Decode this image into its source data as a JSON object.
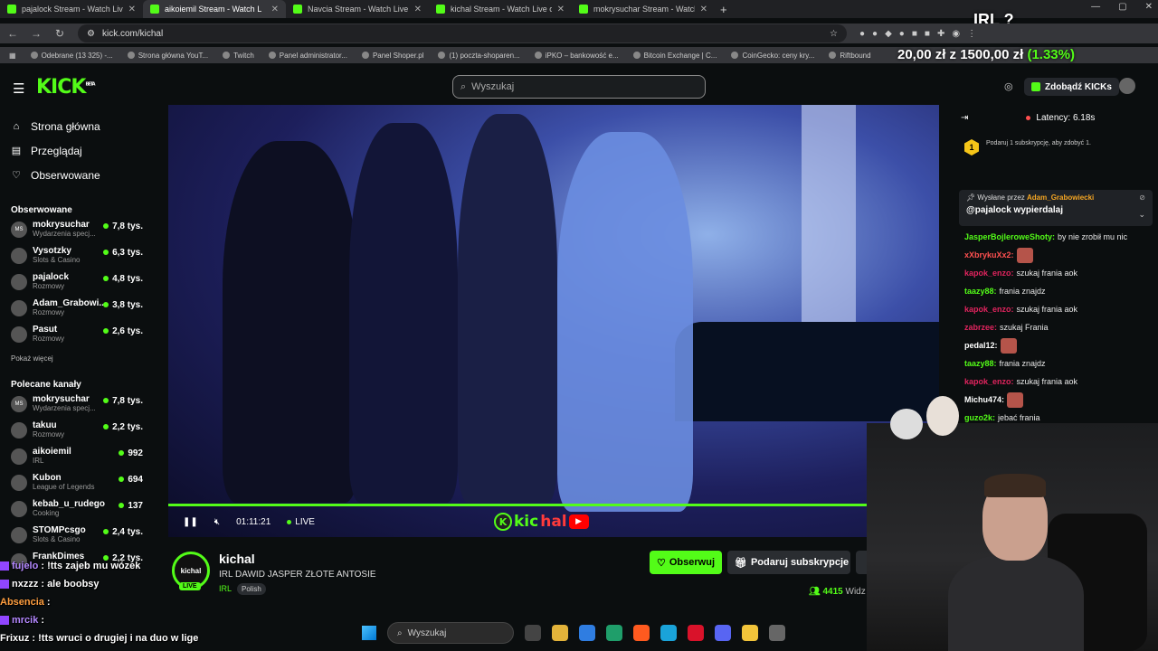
{
  "browser": {
    "tabs": [
      {
        "title": "pajalock Stream - Watch Live on"
      },
      {
        "title": "aikoiemil Stream - Watch L"
      },
      {
        "title": "Navcia Stream - Watch Live on"
      },
      {
        "title": "kichal Stream - Watch Live on"
      },
      {
        "title": "mokrysuchar Stream - Watch Li"
      }
    ],
    "new_tab": "+",
    "url": "kick.com/kichal",
    "bookmarks": [
      "Odebrane (13 325) -...",
      "Strona główna YouT...",
      "Twitch",
      "Panel administrator...",
      "Panel Shoper.pl",
      "(1) poczta-shoparen...",
      "iPKO – bankowość e...",
      "Bitcoin Exchange | C...",
      "CoinGecko: ceny kry...",
      "Riftbound"
    ]
  },
  "overlay": {
    "irl": "IRL ?",
    "price_a": "20,00 zł",
    "price_b": "1500,00 zł",
    "price_pct": "(1.33%)"
  },
  "header": {
    "logo": "KICK",
    "logo_badge": "BETA",
    "search_placeholder": "Wyszukaj",
    "kicks_button": "Zdobądź KICKs"
  },
  "sidebar": {
    "nav": [
      {
        "label": "Strona główna",
        "icon": "home-icon"
      },
      {
        "label": "Przeglądaj",
        "icon": "browse-icon"
      },
      {
        "label": "Obserwowane",
        "icon": "heart-icon"
      }
    ],
    "followed_title": "Obserwowane",
    "followed": [
      {
        "name": "mokrysuchar",
        "category": "Wydarzenia specj...",
        "viewers": "7,8 tys.",
        "avatar": "MS"
      },
      {
        "name": "Vysotzky",
        "category": "Slots & Casino",
        "viewers": "6,3 tys.",
        "avatar": ""
      },
      {
        "name": "pajalock",
        "category": "Rozmowy",
        "viewers": "4,8 tys.",
        "avatar": ""
      },
      {
        "name": "Adam_Grabowi...",
        "category": "Rozmowy",
        "viewers": "3,8 tys.",
        "avatar": ""
      },
      {
        "name": "Pasut",
        "category": "Rozmowy",
        "viewers": "2,6 tys.",
        "avatar": ""
      }
    ],
    "show_more": "Pokaż więcej",
    "recommended_title": "Polecane kanały",
    "recommended": [
      {
        "name": "mokrysuchar",
        "category": "Wydarzenia specj...",
        "viewers": "7,8 tys.",
        "avatar": "MS"
      },
      {
        "name": "takuu",
        "category": "Rozmowy",
        "viewers": "2,2 tys.",
        "avatar": ""
      },
      {
        "name": "aikoiemil",
        "category": "IRL",
        "viewers": "992",
        "avatar": ""
      },
      {
        "name": "Kubon",
        "category": "League of Legends",
        "viewers": "694",
        "avatar": ""
      },
      {
        "name": "kebab_u_rudego",
        "category": "Cooking",
        "viewers": "137",
        "avatar": ""
      },
      {
        "name": "STOMPcsgo",
        "category": "Slots & Casino",
        "viewers": "2,4 tys.",
        "avatar": ""
      },
      {
        "name": "FrankDimes",
        "category": "",
        "viewers": "2,2 tys.",
        "avatar": ""
      }
    ]
  },
  "player": {
    "time": "01:11:21",
    "live": "LIVE",
    "progress": 0.91,
    "brand_k": "K",
    "brand_a": "kic",
    "brand_b": "hal",
    "brand_yt": "▶"
  },
  "stream": {
    "channel": "kichal",
    "avatar_text": "kichal",
    "live_tag": "LIVE",
    "title": "IRL DAWID JASPER ZŁOTE ANTOSIE",
    "category": "IRL",
    "language": "Polish",
    "follow": "Obserwuj",
    "subscribe": "Podaruj subskrypcje",
    "viewers": "4415",
    "viewers_label": "Widz"
  },
  "chat": {
    "latency": "Latency: 6.18s",
    "goal_badge": "1",
    "goal_text": "Podaruj 1 subskrypcję, aby zdobyć 1.",
    "pinned_by_label": "Wysłane przez",
    "pinned_by_user": "Adam_Grabowiecki",
    "pinned_message": "@pajalock wypierdalaj",
    "messages": [
      {
        "user": "JasperBojleroweShoty:",
        "text": "by nie zrobił mu nic",
        "color": "#53fc18",
        "emote": false
      },
      {
        "user": "xXbrykuXx2:",
        "text": "",
        "color": "#ff5050",
        "emote": true
      },
      {
        "user": "kapok_enzo:",
        "text": "szukaj frania aok",
        "color": "#e0245e",
        "emote": false
      },
      {
        "user": "taazy88:",
        "text": "frania znajdz",
        "color": "#53fc18",
        "emote": false
      },
      {
        "user": "kapok_enzo:",
        "text": "szukaj frania aok",
        "color": "#e0245e",
        "emote": false
      },
      {
        "user": "zabrzee:",
        "text": "szukaj Frania",
        "color": "#e0245e",
        "emote": false
      },
      {
        "user": "pedal12:",
        "text": "",
        "color": "#ffffff",
        "emote": true
      },
      {
        "user": "taazy88:",
        "text": "frania znajdz",
        "color": "#53fc18",
        "emote": false
      },
      {
        "user": "kapok_enzo:",
        "text": "szukaj frania aok",
        "color": "#e0245e",
        "emote": false
      },
      {
        "user": "Michu474:",
        "text": "",
        "color": "#ffffff",
        "emote": true
      },
      {
        "user": "guzo2k:",
        "text": "jebać frania",
        "color": "#53fc18",
        "emote": false
      }
    ]
  },
  "stream_overlay_chat": [
    {
      "user": "fujelo",
      "text": ": !tts zajeb mu wózek",
      "color": "#b388ff",
      "platform": "twitch"
    },
    {
      "user": "nxzzz",
      "text": ": ale boobsy",
      "color": "#ffffff",
      "platform": "twitch"
    },
    {
      "user": "Absencia",
      "text": ":",
      "color": "#ff9f40",
      "platform": "none"
    },
    {
      "user": "mrcik",
      "text": ":",
      "color": "#b388ff",
      "platform": "twitch"
    },
    {
      "user": "Frixuz",
      "text": ": !tts wruci o drugiej i na duo w lige",
      "color": "#ffffff",
      "platform": "none"
    }
  ],
  "taskbar": {
    "search_placeholder": "Wyszukaj"
  }
}
